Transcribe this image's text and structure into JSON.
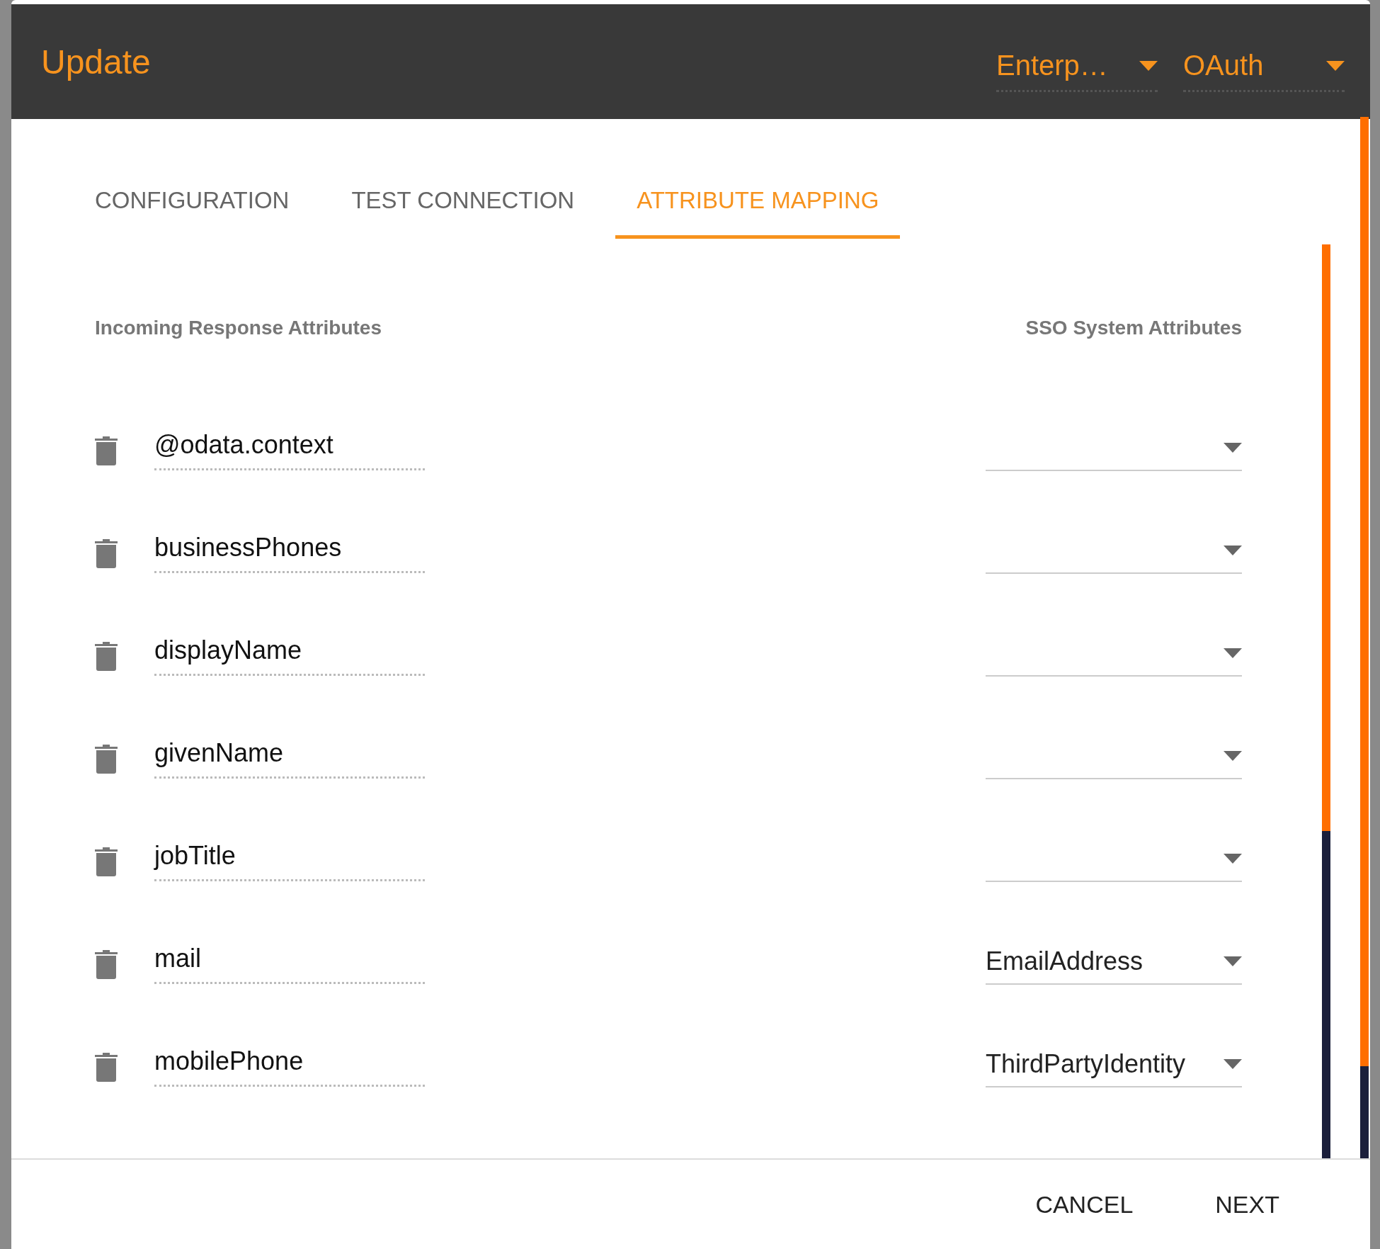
{
  "dialog": {
    "title": "Update",
    "header_selects": [
      {
        "value": "Enterp…"
      },
      {
        "value": "OAuth"
      }
    ],
    "tabs": [
      {
        "label": "CONFIGURATION",
        "selected": false
      },
      {
        "label": "TEST CONNECTION",
        "selected": false
      },
      {
        "label": "ATTRIBUTE MAPPING",
        "selected": true
      }
    ],
    "columns": {
      "incoming": "Incoming Response Attributes",
      "sso": "SSO System Attributes"
    },
    "rows": [
      {
        "attribute": "@odata.context",
        "mapped": ""
      },
      {
        "attribute": "businessPhones",
        "mapped": ""
      },
      {
        "attribute": "displayName",
        "mapped": ""
      },
      {
        "attribute": "givenName",
        "mapped": ""
      },
      {
        "attribute": "jobTitle",
        "mapped": ""
      },
      {
        "attribute": "mail",
        "mapped": "EmailAddress"
      },
      {
        "attribute": "mobilePhone",
        "mapped": "ThirdPartyIdentity"
      }
    ],
    "buttons": [
      "CANCEL",
      "NEXT"
    ]
  }
}
